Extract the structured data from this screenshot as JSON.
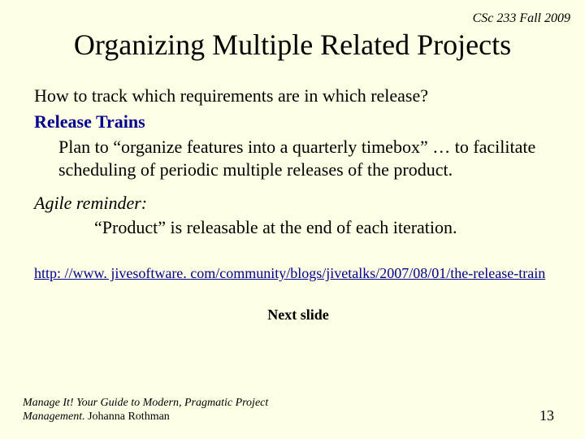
{
  "header": {
    "course": "CSc 233 Fall 2009"
  },
  "title": "Organizing Multiple Related Projects",
  "body": {
    "question": "How to track which requirements are in which release?",
    "release_trains_label": "Release Trains",
    "plan_text": "Plan to “organize features into a quarterly timebox” … to facilitate scheduling of periodic multiple releases of the product.",
    "agile_label": "Agile reminder:",
    "agile_text": "“Product” is releasable at the end of each iteration.",
    "link_text": "http: //www. jivesoftware. com/community/blogs/jivetalks/2007/08/01/the-release-train",
    "next_slide": "Next slide"
  },
  "footer": {
    "book_title": "Manage It! Your Guide to Modern, Pragmatic Project Management.",
    "author": " Johanna Rothman",
    "page": "13"
  }
}
